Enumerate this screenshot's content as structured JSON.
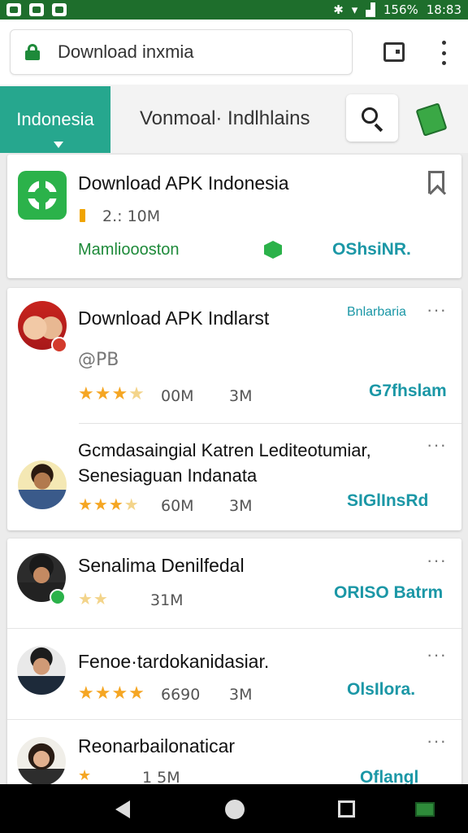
{
  "status_bar": {
    "battery": "156%",
    "time": "18:83"
  },
  "browser": {
    "url": "Download inxmia",
    "active_tab": "Indonesia",
    "tab2": "Vonmoal·  Indlhlains"
  },
  "card1": {
    "title": "Download APK Indonesia",
    "size": "2.: 10M",
    "developer": "Mamlioooston",
    "action": "OShsiNR."
  },
  "card2": {
    "items": [
      {
        "title": "Download APK Indlarst",
        "subtitle": "@PB",
        "top_label": "Bnlarbaria",
        "stars": "★★★",
        "half_star": "★",
        "downloads": "00M",
        "size": "3M",
        "action": "G7fhslam"
      },
      {
        "title_line1": "Gcmdasaingial Katren Lediteotumiar,",
        "title_line2": "Senesiaguan Indanata",
        "stars": "★★★",
        "half_star": "★",
        "downloads": "60M",
        "size": "3M",
        "action": "SIGlInsRd"
      }
    ]
  },
  "card3": {
    "items": [
      {
        "title": "Senalima Denilfedal",
        "stars": "★★",
        "downloads": "31M",
        "action": "ORISO Batrm"
      },
      {
        "title": "Fenoe·tardokanidasiar.",
        "stars": "★★★★",
        "downloads": "6690",
        "size": "3M",
        "action": "OlsIlora."
      },
      {
        "title": "Reonarbailonaticar",
        "stars": "★",
        "downloads": "1 5M",
        "action": "Oflangl"
      }
    ]
  },
  "colors": {
    "accent_teal": "#26a78e",
    "brand_green": "#2bb24a",
    "status_green": "#1e6e2c",
    "link_teal": "#1b97a6",
    "star": "#f5a623"
  }
}
